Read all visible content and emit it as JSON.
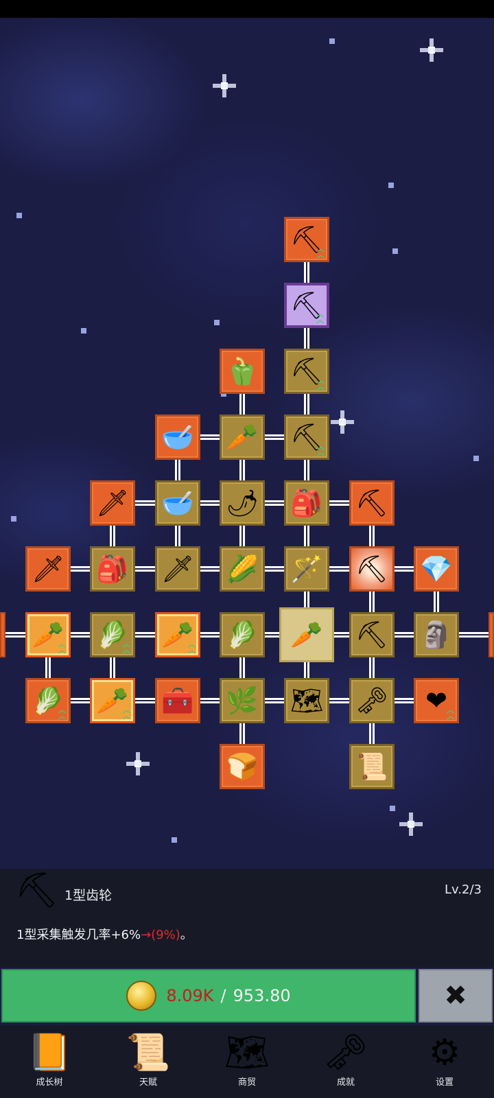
{
  "game": {
    "skill_tree": {
      "nodes": [
        {
          "icon": "shovel-icon",
          "glyph": "⛏",
          "style": "orange",
          "upgrade": true,
          "col": 4,
          "row": 0
        },
        {
          "icon": "shovel-icon",
          "glyph": "⛏",
          "style": "purple",
          "upgrade": true,
          "col": 4,
          "row": 1
        },
        {
          "icon": "bell-pepper-icon",
          "glyph": "🫑",
          "style": "orange",
          "upgrade": false,
          "col": 3,
          "row": 2
        },
        {
          "icon": "shovel-icon",
          "glyph": "⛏",
          "style": "gold",
          "upgrade": true,
          "col": 4,
          "row": 2
        },
        {
          "icon": "bowl-icon",
          "glyph": "🥣",
          "style": "orange",
          "upgrade": false,
          "col": 2,
          "row": 3
        },
        {
          "icon": "radish-icon",
          "glyph": "🥕",
          "style": "gold",
          "upgrade": false,
          "col": 3,
          "row": 3
        },
        {
          "icon": "shovel-icon",
          "glyph": "⛏",
          "style": "gold",
          "upgrade": true,
          "col": 4,
          "row": 3
        },
        {
          "icon": "sword-icon",
          "glyph": "🗡",
          "style": "orange",
          "upgrade": false,
          "col": 1,
          "row": 4
        },
        {
          "icon": "bowl-icon",
          "glyph": "🥣",
          "style": "gold",
          "upgrade": false,
          "col": 2,
          "row": 4
        },
        {
          "icon": "chili-pepper-icon",
          "glyph": "🌶",
          "style": "gold",
          "upgrade": false,
          "col": 3,
          "row": 4
        },
        {
          "icon": "backpack-icon",
          "glyph": "🎒",
          "style": "gold",
          "upgrade": false,
          "col": 4,
          "row": 4
        },
        {
          "icon": "pickaxe-icon",
          "glyph": "⛏",
          "style": "orange",
          "upgrade": false,
          "col": 5,
          "row": 4
        },
        {
          "icon": "sword-icon",
          "glyph": "🗡",
          "style": "orange",
          "upgrade": false,
          "col": 0,
          "row": 5
        },
        {
          "icon": "backpack-icon",
          "glyph": "🎒",
          "style": "gold",
          "upgrade": false,
          "col": 1,
          "row": 5
        },
        {
          "icon": "sword-icon",
          "glyph": "🗡",
          "style": "gold",
          "upgrade": false,
          "col": 2,
          "row": 5
        },
        {
          "icon": "corn-icon",
          "glyph": "🌽",
          "style": "gold",
          "upgrade": false,
          "col": 3,
          "row": 5
        },
        {
          "icon": "stick-icon",
          "glyph": "🪄",
          "style": "gold",
          "upgrade": false,
          "col": 4,
          "row": 5
        },
        {
          "icon": "pickaxe-icon",
          "glyph": "⛏",
          "style": "burst",
          "upgrade": false,
          "col": 5,
          "row": 5
        },
        {
          "icon": "crystal-icon",
          "glyph": "💎",
          "style": "orange",
          "upgrade": false,
          "col": 6,
          "row": 5
        },
        {
          "icon": "carrot-icon",
          "glyph": "🥕",
          "style": "lit",
          "upgrade": true,
          "col": 0,
          "row": 6
        },
        {
          "icon": "cabbage-icon",
          "glyph": "🥬",
          "style": "gold",
          "upgrade": true,
          "col": 1,
          "row": 6
        },
        {
          "icon": "carrot-icon",
          "glyph": "🥕",
          "style": "lit",
          "upgrade": true,
          "col": 2,
          "row": 6
        },
        {
          "icon": "cabbage-icon",
          "glyph": "🥬",
          "style": "gold",
          "upgrade": false,
          "col": 3,
          "row": 6
        },
        {
          "icon": "carrot-icon",
          "glyph": "🥕",
          "style": "selected",
          "upgrade": false,
          "col": 4,
          "row": 6
        },
        {
          "icon": "pickaxe-icon",
          "glyph": "⛏",
          "style": "gold",
          "upgrade": false,
          "col": 5,
          "row": 6
        },
        {
          "icon": "statue-icon",
          "glyph": "🗿",
          "style": "gold",
          "upgrade": false,
          "col": 6,
          "row": 6
        },
        {
          "icon": "cabbage-icon",
          "glyph": "🥬",
          "style": "orange",
          "upgrade": true,
          "col": 0,
          "row": 7
        },
        {
          "icon": "carrot-icon",
          "glyph": "🥕",
          "style": "lit",
          "upgrade": true,
          "col": 1,
          "row": 7
        },
        {
          "icon": "treasure-chest-icon",
          "glyph": "🧰",
          "style": "orange",
          "upgrade": false,
          "col": 2,
          "row": 7
        },
        {
          "icon": "leek-icon",
          "glyph": "🌿",
          "style": "gold",
          "upgrade": false,
          "col": 3,
          "row": 7
        },
        {
          "icon": "map-icon",
          "glyph": "🗺",
          "style": "gold",
          "upgrade": false,
          "col": 4,
          "row": 7
        },
        {
          "icon": "key-icon",
          "glyph": "🗝",
          "style": "gold",
          "upgrade": false,
          "col": 5,
          "row": 7
        },
        {
          "icon": "heart-icon",
          "glyph": "❤",
          "style": "orange",
          "upgrade": true,
          "col": 6,
          "row": 7
        },
        {
          "icon": "bread-icon",
          "glyph": "🍞",
          "style": "orange",
          "upgrade": false,
          "col": 3,
          "row": 8
        },
        {
          "icon": "scroll-icon",
          "glyph": "📜",
          "style": "gold",
          "upgrade": false,
          "col": 5,
          "row": 8
        }
      ]
    },
    "info_panel": {
      "icon": "pickaxe-icon",
      "icon_glyph": "⛏",
      "name": "1型齿轮",
      "level": "Lv.2/3",
      "desc_prefix": "1型采集触发几率+6%",
      "desc_new": "→(9%)",
      "desc_suffix": "。"
    },
    "upgrade": {
      "cost": "8.09K",
      "separator": "/",
      "balance": "953.80"
    },
    "close_label": "✖",
    "nav": [
      {
        "label": "成长树",
        "icon": "book-icon",
        "glyph": "📙"
      },
      {
        "label": "天赋",
        "icon": "scroll-icon",
        "glyph": "📜"
      },
      {
        "label": "商贸",
        "icon": "map-icon",
        "glyph": "🗺"
      },
      {
        "label": "成就",
        "icon": "key-icon",
        "glyph": "🗝"
      },
      {
        "label": "设置",
        "icon": "gear-icon",
        "glyph": "⚙"
      }
    ]
  }
}
